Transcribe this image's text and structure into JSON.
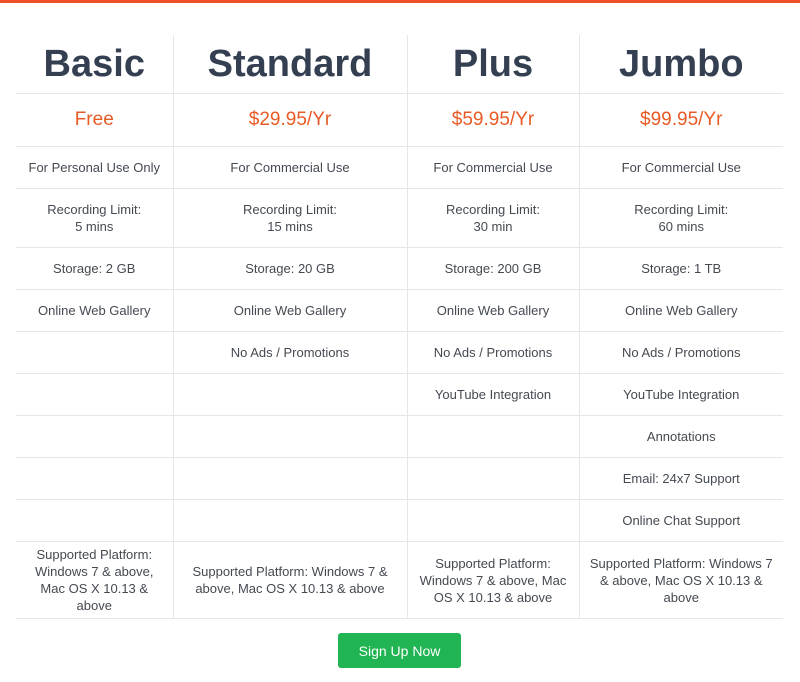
{
  "colors": {
    "accent": "#ee4f24",
    "price": "#e85a25",
    "heading": "#343f52",
    "text": "#444a52",
    "button": "#20b452"
  },
  "plans": [
    {
      "name": "Basic",
      "price": "Free",
      "usage": "For Personal Use Only",
      "recording_limit": [
        "Recording Limit:",
        "5 mins"
      ],
      "storage": "Storage: 2 GB",
      "gallery": "Online Web Gallery",
      "no_ads": "",
      "youtube": "",
      "annotations": "",
      "email_support": "",
      "chat_support": "",
      "platform": "Supported Platform: Windows 7 & above, Mac OS X 10.13 & above"
    },
    {
      "name": "Standard",
      "price": "$29.95/Yr",
      "usage": "For Commercial Use",
      "recording_limit": [
        "Recording Limit:",
        "15 mins"
      ],
      "storage": "Storage: 20 GB",
      "gallery": "Online Web Gallery",
      "no_ads": "No Ads / Promotions",
      "youtube": "",
      "annotations": "",
      "email_support": "",
      "chat_support": "",
      "platform": "Supported Platform: Windows 7 & above, Mac OS X 10.13 & above"
    },
    {
      "name": "Plus",
      "price": "$59.95/Yr",
      "usage": "For Commercial Use",
      "recording_limit": [
        "Recording Limit:",
        "30 min"
      ],
      "storage": "Storage: 200 GB",
      "gallery": "Online Web Gallery",
      "no_ads": "No Ads / Promotions",
      "youtube": "YouTube Integration",
      "annotations": "",
      "email_support": "",
      "chat_support": "",
      "platform": "Supported Platform: Windows 7 & above, Mac OS X 10.13 & above"
    },
    {
      "name": "Jumbo",
      "price": "$99.95/Yr",
      "usage": "For Commercial Use",
      "recording_limit": [
        "Recording Limit:",
        "60 mins"
      ],
      "storage": "Storage: 1 TB",
      "gallery": "Online Web Gallery",
      "no_ads": "No Ads / Promotions",
      "youtube": "YouTube Integration",
      "annotations": "Annotations",
      "email_support": "Email: 24x7 Support",
      "chat_support": "Online Chat Support",
      "platform": "Supported Platform: Windows 7 & above, Mac OS X 10.13 & above"
    }
  ],
  "signup": {
    "label": "Sign Up Now"
  }
}
